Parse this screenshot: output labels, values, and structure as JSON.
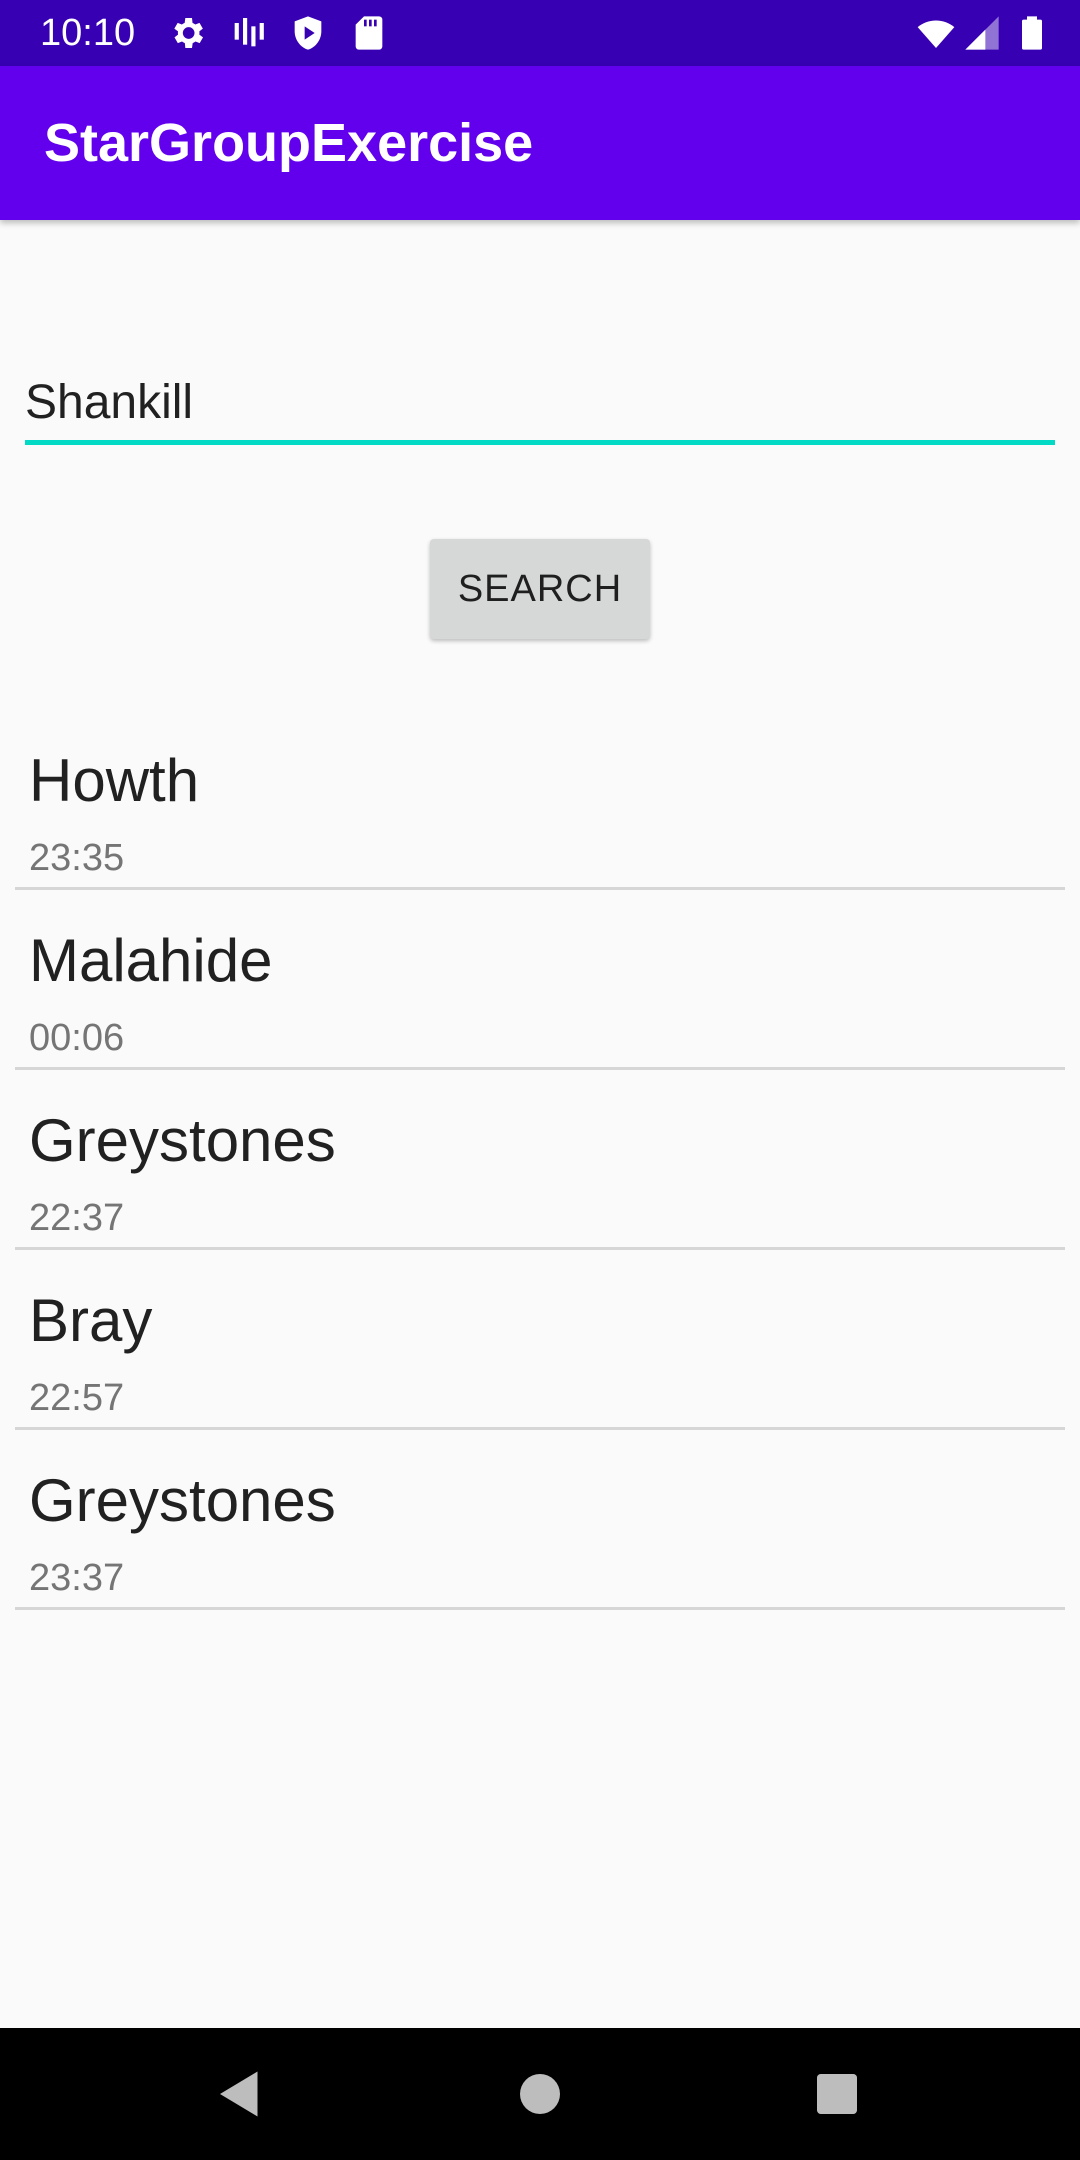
{
  "status_bar": {
    "time": "10:10",
    "icons": [
      "settings-icon",
      "signal-strength-icon",
      "shield-play-icon",
      "sd-card-icon",
      "wifi-icon",
      "cellular-signal-icon",
      "battery-icon"
    ]
  },
  "app_bar": {
    "title": "StarGroupExercise"
  },
  "search": {
    "value": "Shankill",
    "button_label": "SEARCH"
  },
  "results": [
    {
      "name": "Howth",
      "time": "23:35"
    },
    {
      "name": "Malahide",
      "time": "00:06"
    },
    {
      "name": "Greystones",
      "time": "22:37"
    },
    {
      "name": "Bray",
      "time": "22:57"
    },
    {
      "name": "Greystones",
      "time": "23:37"
    }
  ],
  "nav_bar": {
    "icons": [
      "back-icon",
      "home-icon",
      "recents-icon"
    ]
  },
  "colors": {
    "status_bar": "#3700b3",
    "app_bar": "#6200ee",
    "accent": "#03dac5",
    "background": "#fafafa"
  }
}
